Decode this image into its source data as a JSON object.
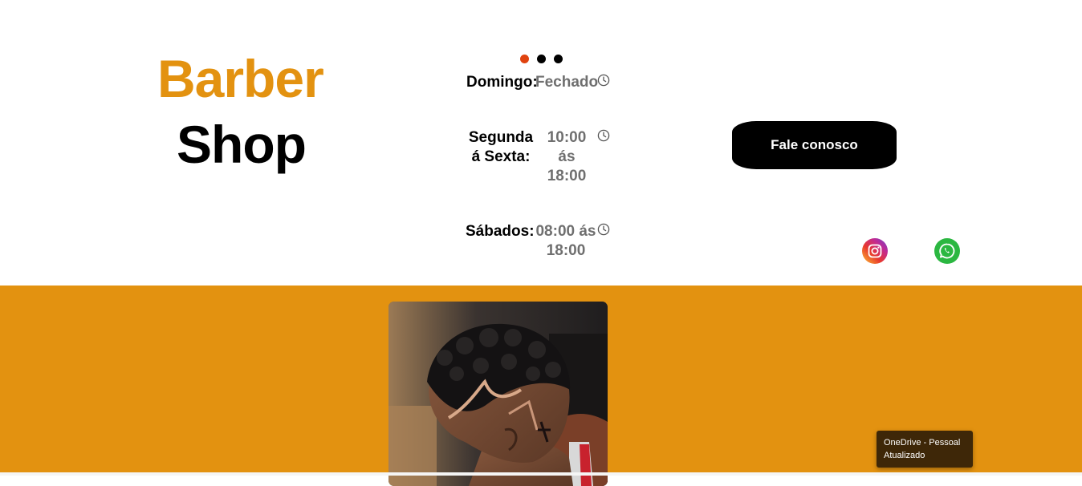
{
  "brand": {
    "line1": "Barber",
    "line2": "Shop",
    "accent_color": "#e39210"
  },
  "carousel": {
    "dot_count": 3,
    "active_index": 0,
    "active_color": "#e0430f"
  },
  "hours": [
    {
      "label": "Domingo:",
      "value": "Fechado"
    },
    {
      "label_lines": [
        "Segunda",
        "á Sexta:"
      ],
      "value_lines": [
        "10:00",
        "ás",
        "18:00"
      ]
    },
    {
      "label": "Sábados:",
      "value_lines": [
        "08:00 ás",
        "18:00"
      ]
    }
  ],
  "cta": {
    "label": "Fale conosco"
  },
  "social": {
    "instagram": "instagram-icon",
    "whatsapp": "whatsapp-icon"
  },
  "notification": {
    "line1": "OneDrive - Pessoal",
    "line2": "Atualizado"
  }
}
